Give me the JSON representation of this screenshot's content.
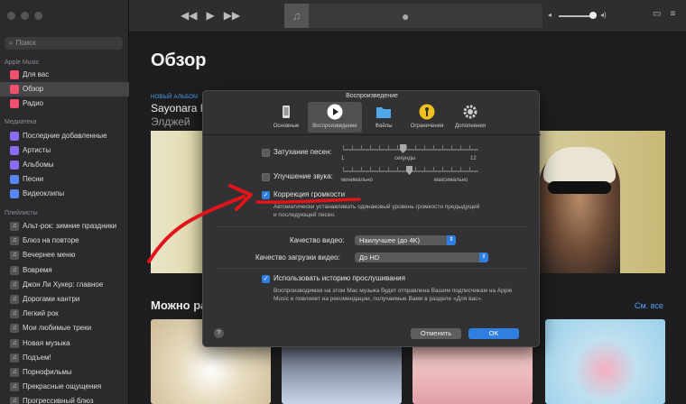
{
  "sidebar": {
    "search_placeholder": "Поиск",
    "section_apple_music": "Apple Music",
    "apple_music_items": [
      {
        "label": "Для вас",
        "color": "#f0506e"
      },
      {
        "label": "Обзор",
        "color": "#f0506e"
      },
      {
        "label": "Радио",
        "color": "#f0506e"
      }
    ],
    "section_library": "Медиатека",
    "library_items": [
      {
        "label": "Последние добавленные",
        "color": "#8a6cf0"
      },
      {
        "label": "Артисты",
        "color": "#8a6cf0"
      },
      {
        "label": "Альбомы",
        "color": "#8a6cf0"
      },
      {
        "label": "Песни",
        "color": "#5a84f0"
      },
      {
        "label": "Видеоклипы",
        "color": "#5a84f0"
      }
    ],
    "section_playlists": "Плейлисты",
    "playlists": [
      "Альт-рок: зимние праздники",
      "Блюз на повторе",
      "Вечернее меню",
      "Вовремя",
      "Джон Ли Хукер: главное",
      "Дорогами кантри",
      "Легкий рок",
      "Мои любимые треки",
      "Новая музыка",
      "Подъем!",
      "Порнофильмы",
      "Прекрасные ощущения",
      "Прогрессивный блюз"
    ]
  },
  "main": {
    "title": "Обзор",
    "new_album_label": "НОВЫЙ АЛЬБОМ",
    "album_title": "Sayonara B",
    "album_artist": "Элджей",
    "more_heading": "Можно ра",
    "see_all": "См. все"
  },
  "dialog": {
    "title": "Воспроизведение",
    "tabs": [
      {
        "label": "Основные",
        "icon": "phone-icon"
      },
      {
        "label": "Воспроизведение",
        "icon": "play-icon"
      },
      {
        "label": "Файлы",
        "icon": "folder-icon"
      },
      {
        "label": "Ограничения",
        "icon": "parental-icon"
      },
      {
        "label": "Дополнения",
        "icon": "gear-icon"
      }
    ],
    "crossfade_label": "Затухание песен:",
    "crossfade_min": "1",
    "crossfade_unit": "секунды",
    "crossfade_max": "12",
    "sound_enhancer_label": "Улучшение звука:",
    "enhancer_min": "минимально",
    "enhancer_max": "максимально",
    "sound_check_label": "Коррекция громкости",
    "sound_check_desc": "Автоматически устанавливать одинаковый уровень громкости предыдущей и последующей песен.",
    "video_quality_label": "Качество видео:",
    "video_quality_value": "Наилучшее (до 4K)",
    "download_quality_label": "Качество загрузки видео:",
    "download_quality_value": "До HD",
    "history_label": "Использовать историю прослушивания",
    "history_desc": "Воспроизводимая на этом Mac музыка будет отправлена Вашим подписчикам на Apple Music и повлияет на рекомендации, получаемые Вами в разделе «Для вас».",
    "help": "?",
    "cancel": "Отменить",
    "ok": "OK"
  },
  "colors": {
    "accent": "#2f7fe0",
    "annotation": "#e0141a",
    "link": "#4aa3f5"
  }
}
